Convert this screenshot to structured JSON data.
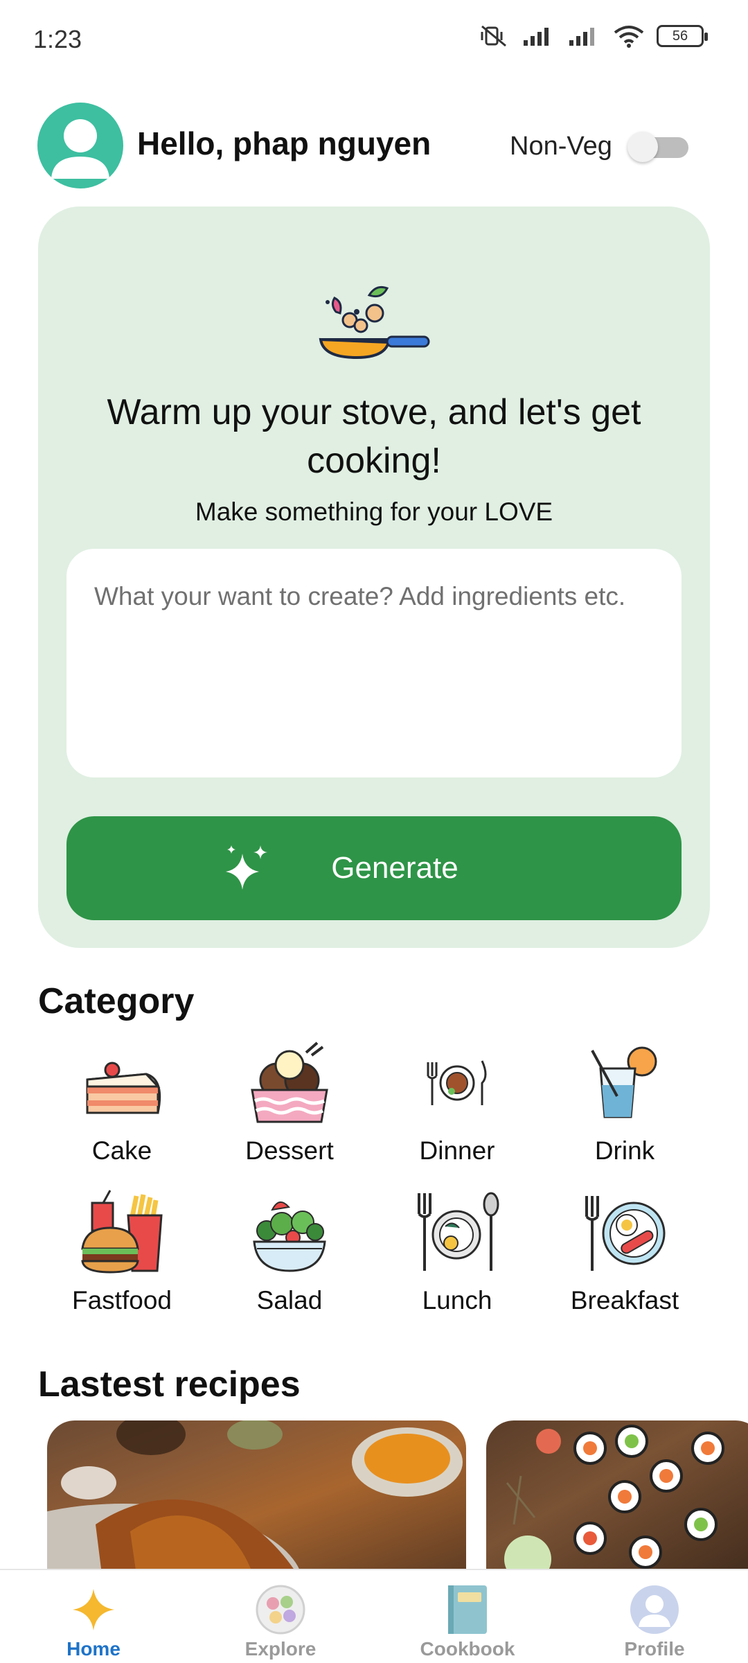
{
  "status_bar": {
    "time": "1:23",
    "battery": "56",
    "icons": [
      "mute-vibrate-icon",
      "signal-icon",
      "signal-icon",
      "wifi-icon",
      "battery-icon"
    ]
  },
  "header": {
    "greeting": "Hello, phap nguyen",
    "diet_toggle_label": "Non-Veg",
    "diet_toggle_on": false
  },
  "hero": {
    "title": "Warm up your stove, and let's get cooking!",
    "subtitle": "Make something for your LOVE",
    "prompt_placeholder": "What your want to create? Add ingredients etc.",
    "prompt_value": "",
    "generate_label": "Generate"
  },
  "category": {
    "title": "Category",
    "items": [
      {
        "label": "Cake",
        "icon": "cake-icon"
      },
      {
        "label": "Dessert",
        "icon": "dessert-icon"
      },
      {
        "label": "Dinner",
        "icon": "dinner-icon"
      },
      {
        "label": "Drink",
        "icon": "drink-icon"
      },
      {
        "label": "Fastfood",
        "icon": "fastfood-icon"
      },
      {
        "label": "Salad",
        "icon": "salad-icon"
      },
      {
        "label": "Lunch",
        "icon": "lunch-icon"
      },
      {
        "label": "Breakfast",
        "icon": "breakfast-icon"
      }
    ]
  },
  "latest": {
    "title": "Lastest recipes"
  },
  "nav": {
    "items": [
      {
        "label": "Home",
        "icon": "sparkle-icon",
        "active": true
      },
      {
        "label": "Explore",
        "icon": "explore-icon",
        "active": false
      },
      {
        "label": "Cookbook",
        "icon": "cookbook-icon",
        "active": false
      },
      {
        "label": "Profile",
        "icon": "profile-icon",
        "active": false
      }
    ]
  },
  "colors": {
    "accent_green": "#2e9447",
    "hero_bg": "#e0efe2",
    "avatar_bg": "#3dbfa0",
    "nav_active": "#1e73c8"
  }
}
